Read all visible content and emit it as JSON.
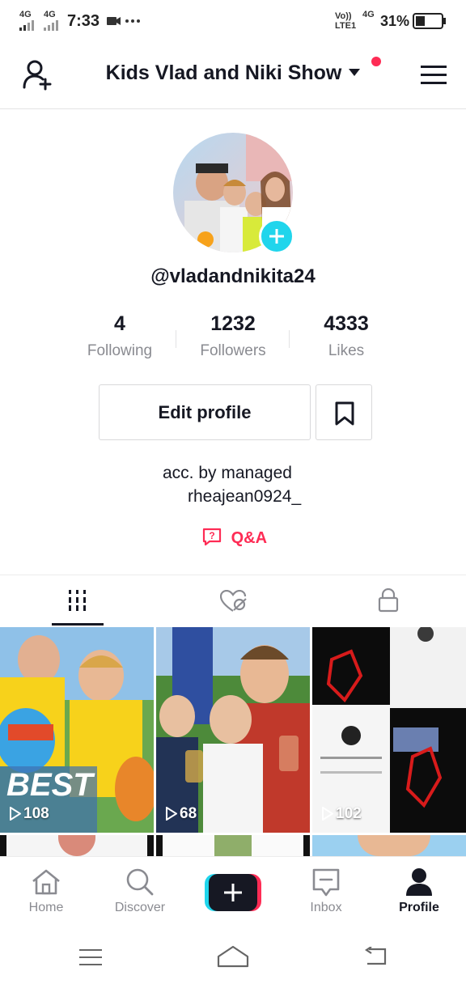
{
  "status_bar": {
    "net1": "4G",
    "net2": "4G",
    "time": "7:33",
    "volte": "Vo))",
    "lte": "LTE1",
    "net3": "4G",
    "battery": "31%"
  },
  "header": {
    "title": "Kids Vlad and Niki Show"
  },
  "profile": {
    "username": "@vladandnikita24",
    "stats": [
      {
        "value": "4",
        "label": "Following"
      },
      {
        "value": "1232",
        "label": "Followers"
      },
      {
        "value": "4333",
        "label": "Likes"
      }
    ],
    "edit_label": "Edit profile",
    "bio_line1": "acc. by managed",
    "bio_line2": "rheajean0924_",
    "qa_label": "Q&A"
  },
  "videos": [
    {
      "views": "108"
    },
    {
      "views": "68"
    },
    {
      "views": "102"
    }
  ],
  "nav": {
    "home": "Home",
    "discover": "Discover",
    "inbox": "Inbox",
    "profile": "Profile"
  },
  "colors": {
    "accent": "#fe2c55",
    "teal": "#20d5ec",
    "text": "#161823",
    "muted": "#8a8b91"
  }
}
